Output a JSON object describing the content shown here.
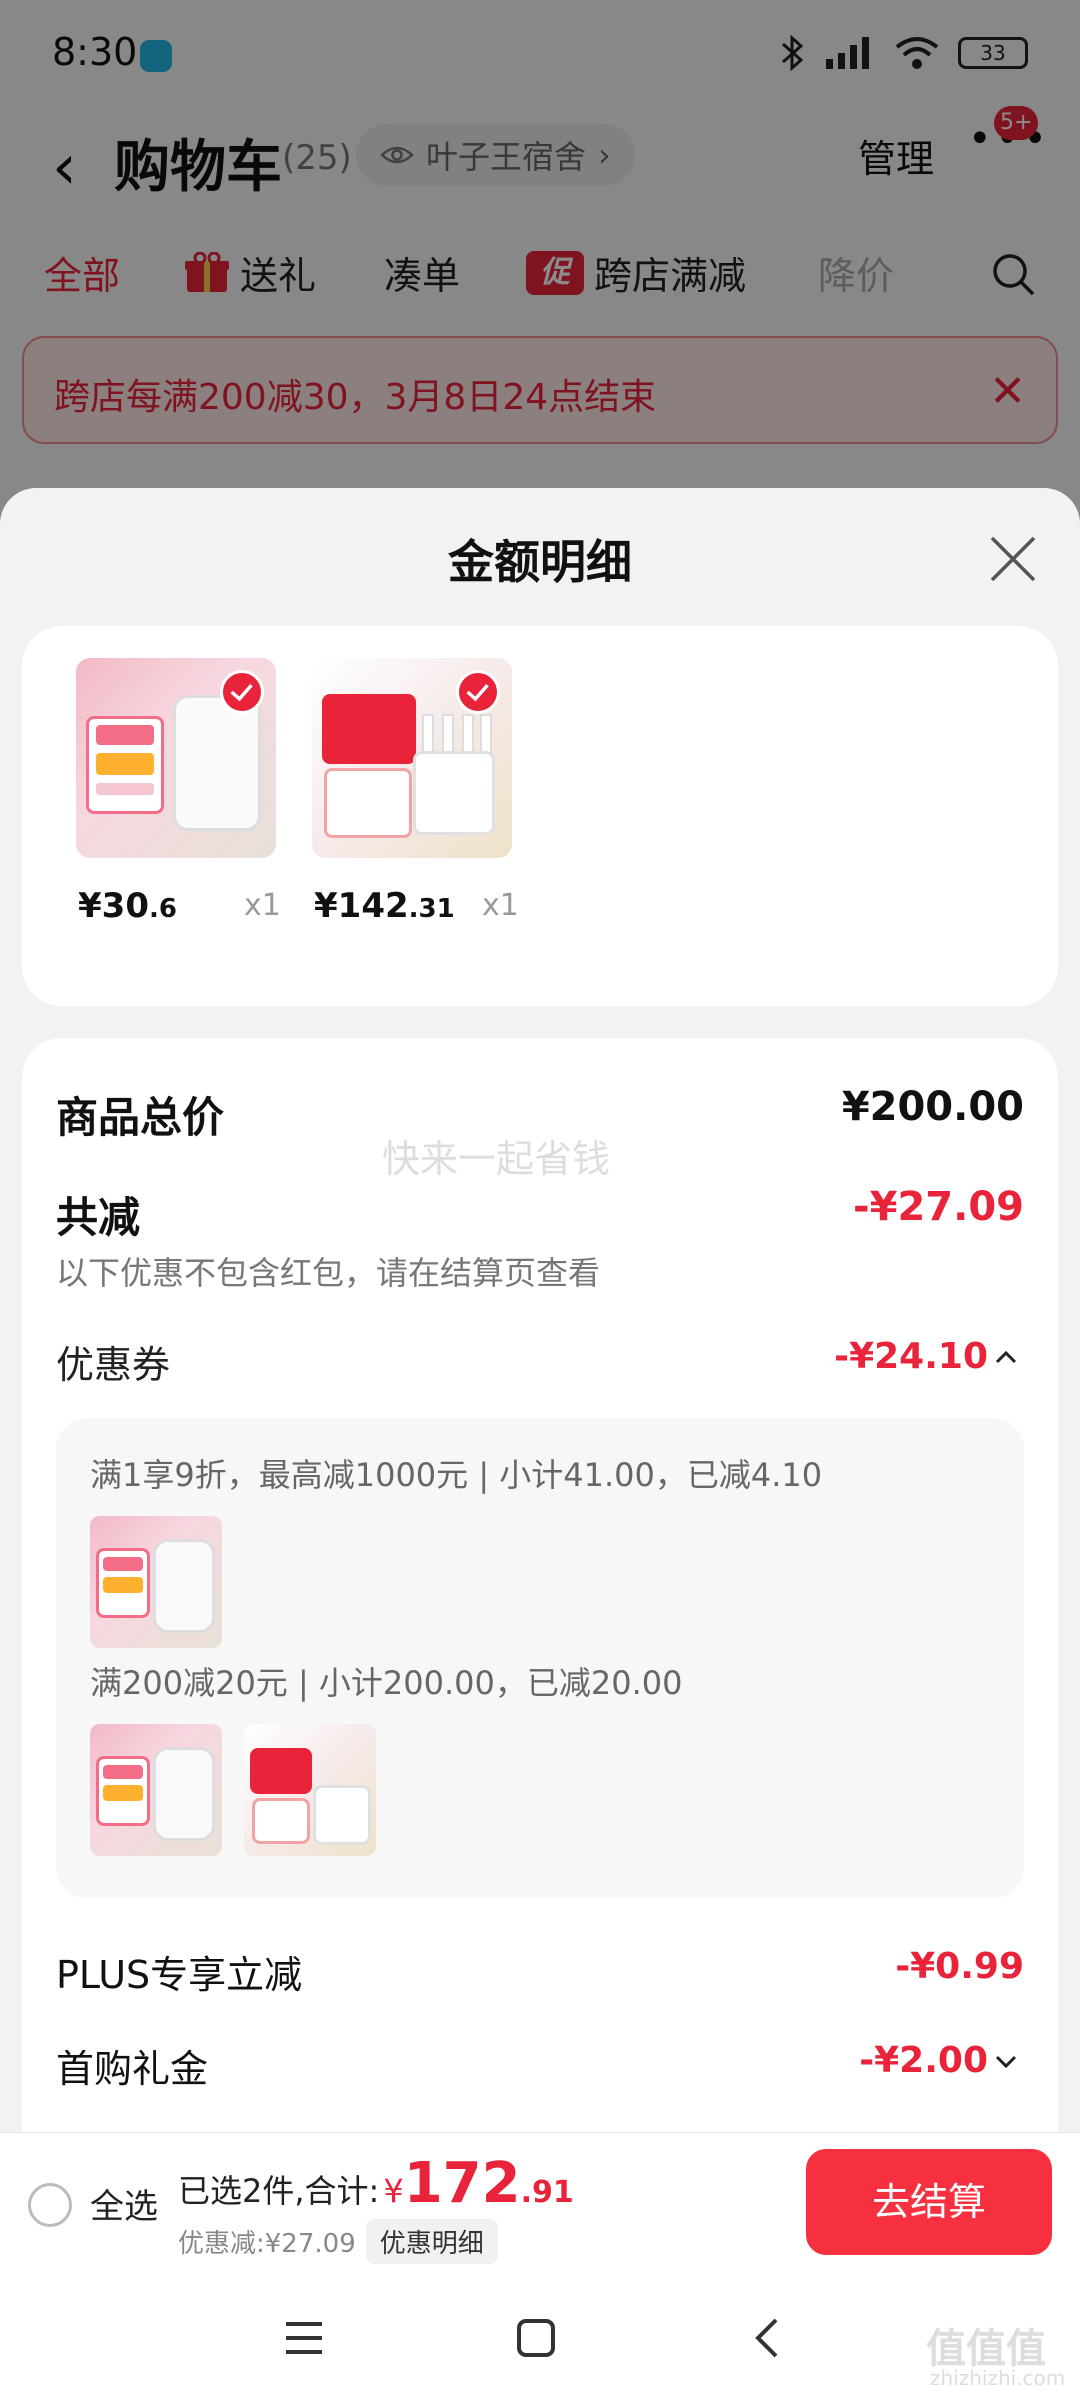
{
  "status_bar": {
    "time": "8:30",
    "battery": "33"
  },
  "nav": {
    "title": "购物车",
    "count": "(25)",
    "address": "叶子王宿舍",
    "manage": "管理",
    "badge": "5+"
  },
  "tabs": [
    {
      "label": "全部"
    },
    {
      "label": "送礼"
    },
    {
      "label": "凑单"
    },
    {
      "label": "跨店满减",
      "promo_tag": "促"
    },
    {
      "label": "降价"
    }
  ],
  "promo_banner": {
    "text": "跨店每满200减30，3月8日24点结束"
  },
  "sheet": {
    "title": "金额明细",
    "goods": [
      {
        "price_int": "¥30",
        "price_dec": ".6",
        "qty": "x1"
      },
      {
        "price_int": "¥142",
        "price_dec": ".31",
        "qty": "x1"
      }
    ],
    "total_label": "商品总价",
    "total_value": "¥200.00",
    "watermark": "快来一起省钱",
    "reduce_label": "共减",
    "reduce_value": "-¥27.09",
    "reduce_note": "以下优惠不包含红包，请在结算页查看",
    "coupon_label": "优惠券",
    "coupon_value": "-¥24.10",
    "coupons": [
      {
        "desc": "满1享9折，最高减1000元 | 小计41.00，已减4.10"
      },
      {
        "desc": "满200减20元 | 小计200.00，已减20.00"
      }
    ],
    "plus_label": "PLUS专享立减",
    "plus_value": "-¥0.99",
    "first_label": "首购礼金",
    "first_value": "-¥2.00"
  },
  "bottom_bar": {
    "select_all": "全选",
    "selected_text": "已选2件,合计:",
    "yen": "¥",
    "total_int": "172",
    "total_dec": ".91",
    "discount_text": "优惠减:¥27.09",
    "detail_btn": "优惠明细",
    "checkout": "去结算"
  },
  "watermark_logo": {
    "mark": "值值值",
    "url": "zhizhizhi.com"
  },
  "colors": {
    "accent": "#e8233a",
    "checkout": "#f6303f",
    "dim": "rgba(0,0,0,0.45)"
  }
}
